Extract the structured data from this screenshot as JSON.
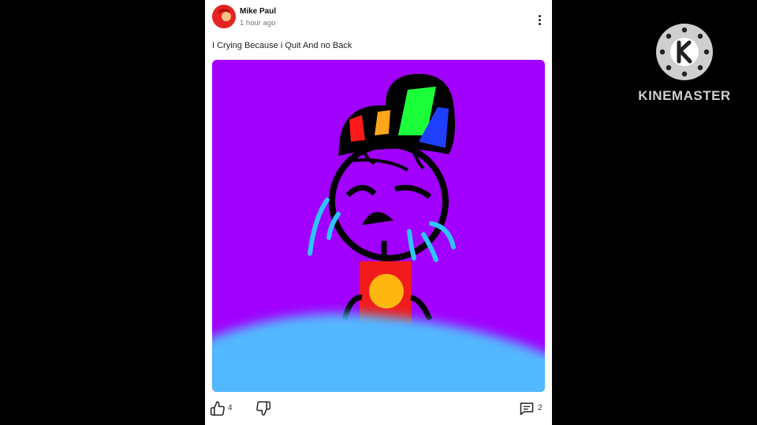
{
  "post": {
    "author": "Mike Paul",
    "timestamp": "1 hour ago",
    "caption": "I Crying Because i Quit And no Back",
    "likes": "4",
    "comments": "2"
  },
  "icons": {
    "more": "more-vertical-icon",
    "like": "thumbs-up-icon",
    "dislike": "thumbs-down-icon",
    "comment": "comment-icon"
  },
  "watermark": {
    "text": "KINEMASTER"
  },
  "colors": {
    "image_background": "#a100ff",
    "avatar": "#e52521",
    "watermark": "#cfcfcf"
  }
}
